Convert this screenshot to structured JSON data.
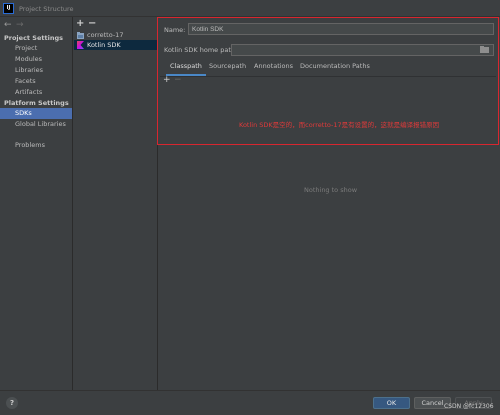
{
  "window": {
    "title": "Project Structure",
    "logo_text": "IJ"
  },
  "nav": {
    "back_icon": "←",
    "forward_icon": "→",
    "project_settings_header": "Project Settings",
    "project_items": [
      "Project",
      "Modules",
      "Libraries",
      "Facets",
      "Artifacts"
    ],
    "platform_settings_header": "Platform Settings",
    "platform_items": [
      "SDKs",
      "Global Libraries"
    ],
    "problems": "Problems",
    "selected": "SDKs"
  },
  "sdk_list": {
    "add_icon": "+",
    "remove_icon": "−",
    "items": [
      "corretto-17",
      "Kotlin SDK"
    ],
    "selected": "Kotlin SDK"
  },
  "detail": {
    "name_label": "Name:",
    "name_value": "Kotlin SDK",
    "home_path_label": "Kotlin SDK home path:",
    "home_path_value": "",
    "folder_icon": "folder-icon",
    "tabs": [
      "Classpath",
      "Sourcepath",
      "Annotations",
      "Documentation Paths"
    ],
    "active_tab": "Classpath",
    "add_icon": "+",
    "remove_icon": "−",
    "empty_text": "Nothing to show"
  },
  "annotation": {
    "text": "Kotlin SDK是空的，而corretto-17是有设置的，这就是编译报错原因",
    "color": "#d8262f"
  },
  "footer": {
    "help_label": "?",
    "ok_label": "OK",
    "cancel_label": "Cancel",
    "apply_label": "Apply",
    "watermark": "CSDN @fc12306"
  },
  "colors": {
    "accent": "#4b6eaf",
    "ok_button": "#365880",
    "background": "#3c3f41",
    "annotation": "#d8262f"
  }
}
